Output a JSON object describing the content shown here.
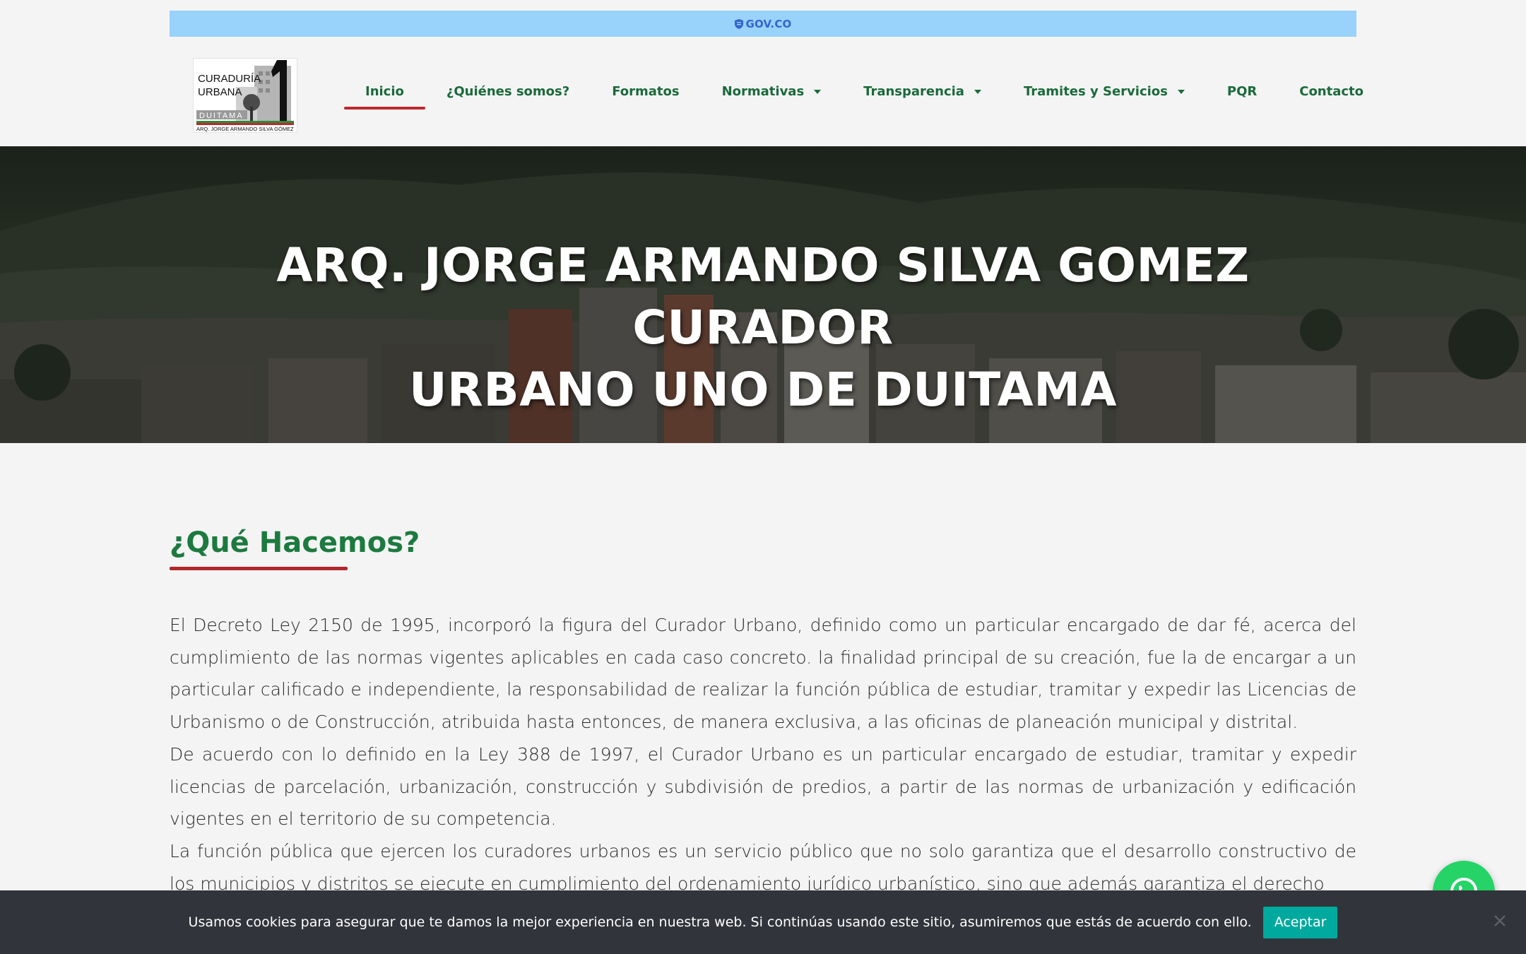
{
  "govbar": {
    "label": "GOV.CO",
    "icon": "gov-shield-icon"
  },
  "logo": {
    "line1": "CURADURÍA",
    "line2": "URBANA",
    "city": "DUITAMA",
    "numeral": "1",
    "owner": "ARQ. JORGE ARMANDO SILVA GÓMEZ"
  },
  "nav": {
    "items": [
      {
        "label": "Inicio",
        "active": true,
        "dropdown": false
      },
      {
        "label": "¿Quiénes somos?",
        "active": false,
        "dropdown": false
      },
      {
        "label": "Formatos",
        "active": false,
        "dropdown": false
      },
      {
        "label": "Normativas",
        "active": false,
        "dropdown": true
      },
      {
        "label": "Transparencia",
        "active": false,
        "dropdown": true
      },
      {
        "label": "Tramites y Servicios",
        "active": false,
        "dropdown": true
      },
      {
        "label": "PQR",
        "active": false,
        "dropdown": false
      },
      {
        "label": "Contacto",
        "active": false,
        "dropdown": false
      }
    ]
  },
  "hero": {
    "title_line1": "ARQ. JORGE ARMANDO SILVA GOMEZ CURADOR",
    "title_line2": "URBANO UNO DE DUITAMA"
  },
  "section": {
    "title": "¿Qué Hacemos?",
    "paragraphs": [
      "El Decreto Ley 2150 de 1995, incorporó la figura del Curador Urbano, definido como un particular encargado de dar fé, acerca del cumplimiento de las normas vigentes aplicables en cada caso concreto. la finalidad principal de su creación, fue la de encargar a un particular calificado e independiente, la responsabilidad de realizar la función pública de estudiar, tramitar y expedir las Licencias de Urbanismo o de Construcción, atribuida hasta entonces, de manera exclusiva, a las oficinas de planeación municipal y distrital.",
      "De acuerdo con lo definido en la Ley 388 de 1997, el Curador Urbano es un particular encargado de estudiar, tramitar y expedir licencias de parcelación, urbanización, construcción y subdivisión de predios, a partir de las normas de urbanización y edificación vigentes en el territorio de su competencia.",
      "La función pública que ejercen los curadores urbanos es un servicio público que no solo garantiza que el desarrollo constructivo de los municipios y distritos se ejecute en cumplimiento del ordenamiento jurídico urbanístico, sino que además garantiza el derecho"
    ]
  },
  "whatsapp": {
    "icon": "whatsapp-icon"
  },
  "cookie": {
    "text": "Usamos cookies para asegurar que te damos la mejor experiencia en nuestra web. Si continúas usando este sitio, asumiremos que estás de acuerdo con ello.",
    "accept_label": "Aceptar",
    "close_icon": "close-icon"
  },
  "colors": {
    "gov_blue": "#99d2fb",
    "nav_green": "#1a6a3b",
    "title_green": "#1d7a3f",
    "accent_red": "#c0282d",
    "cookie_bg": "#32343b",
    "accept_teal": "#00a99d",
    "whatsapp_green": "#25d366"
  }
}
